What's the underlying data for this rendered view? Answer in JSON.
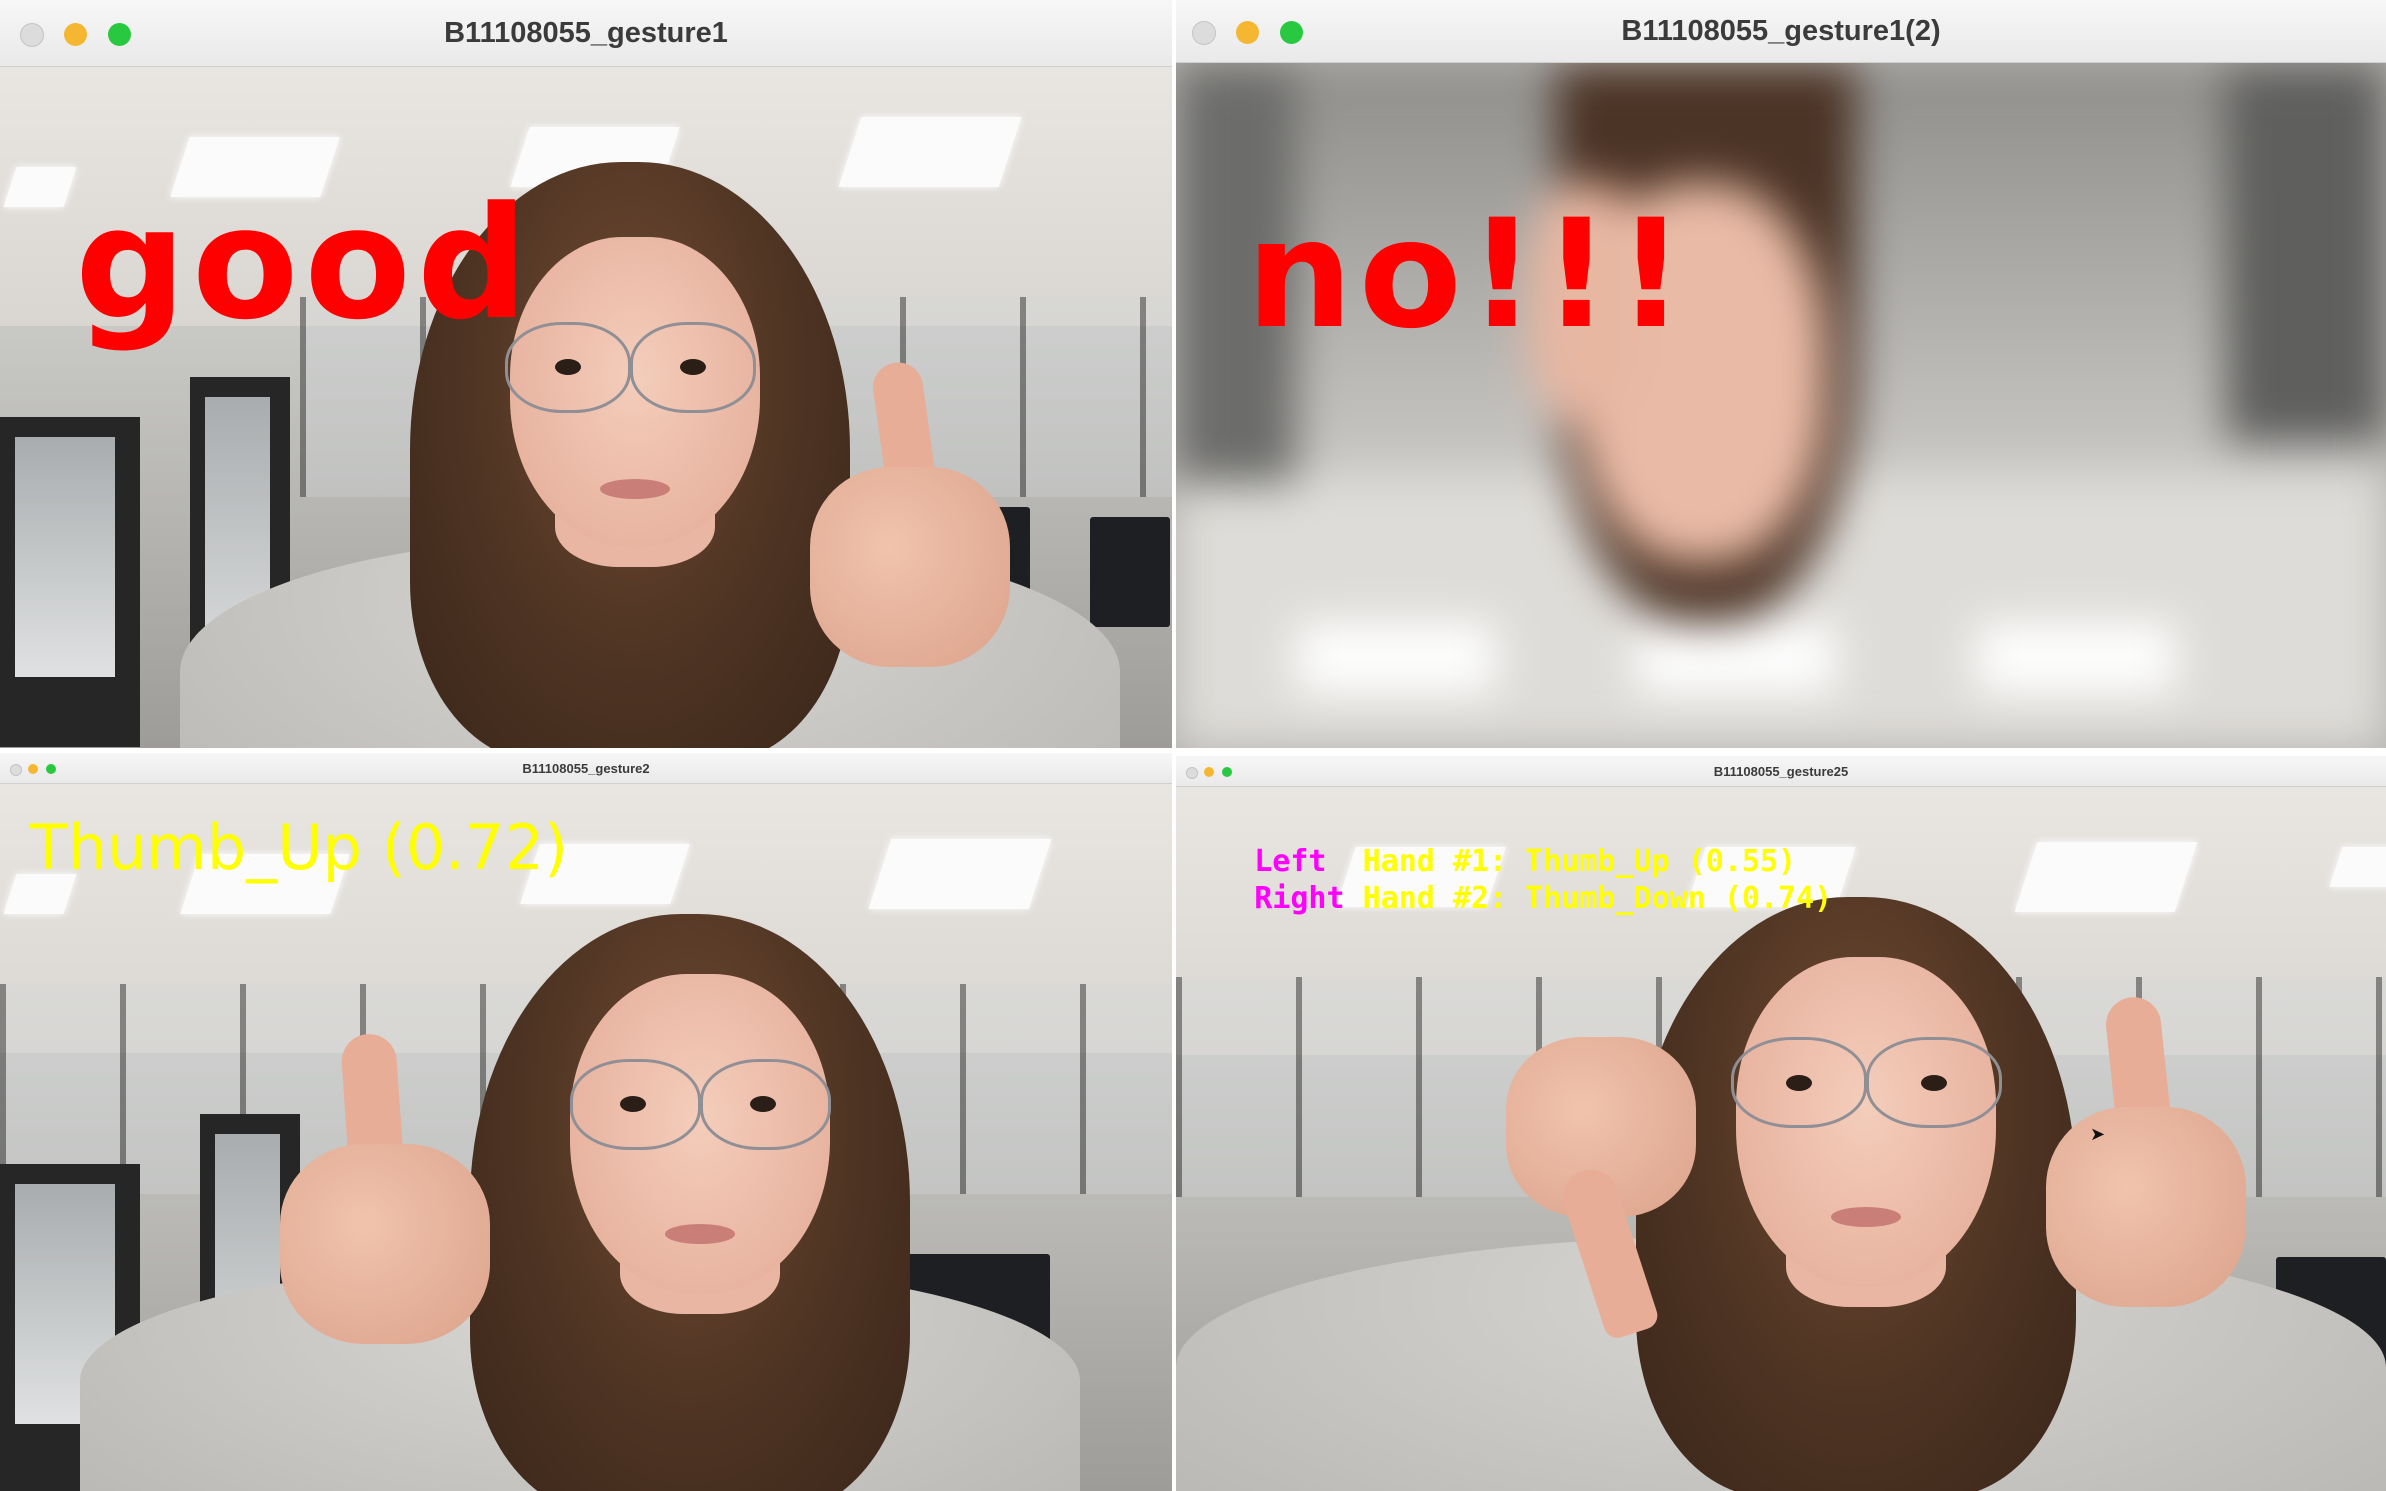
{
  "windows": [
    {
      "title": "B11108055_gesture1",
      "overlay": "good"
    },
    {
      "title": "B11108055_gesture1(2)",
      "overlay": "no!!!"
    },
    {
      "title": "B11108055_gesture2",
      "overlay": "Thumb_Up (0.72)"
    },
    {
      "title": "B11108055_gesture25",
      "lines": [
        {
          "hand": "Left",
          "text": "Hand #1: Thumb_Up (0.55)"
        },
        {
          "hand": "Right",
          "text": "Hand #2: Thumb_Down (0.74)"
        }
      ]
    }
  ],
  "colors": {
    "traffic_close": "#e0e0e0",
    "traffic_min": "#f5b731",
    "traffic_max": "#28c840",
    "overlay_red": "#ff0000",
    "overlay_yellow": "#ffff00",
    "overlay_magenta": "#ff00ff"
  }
}
